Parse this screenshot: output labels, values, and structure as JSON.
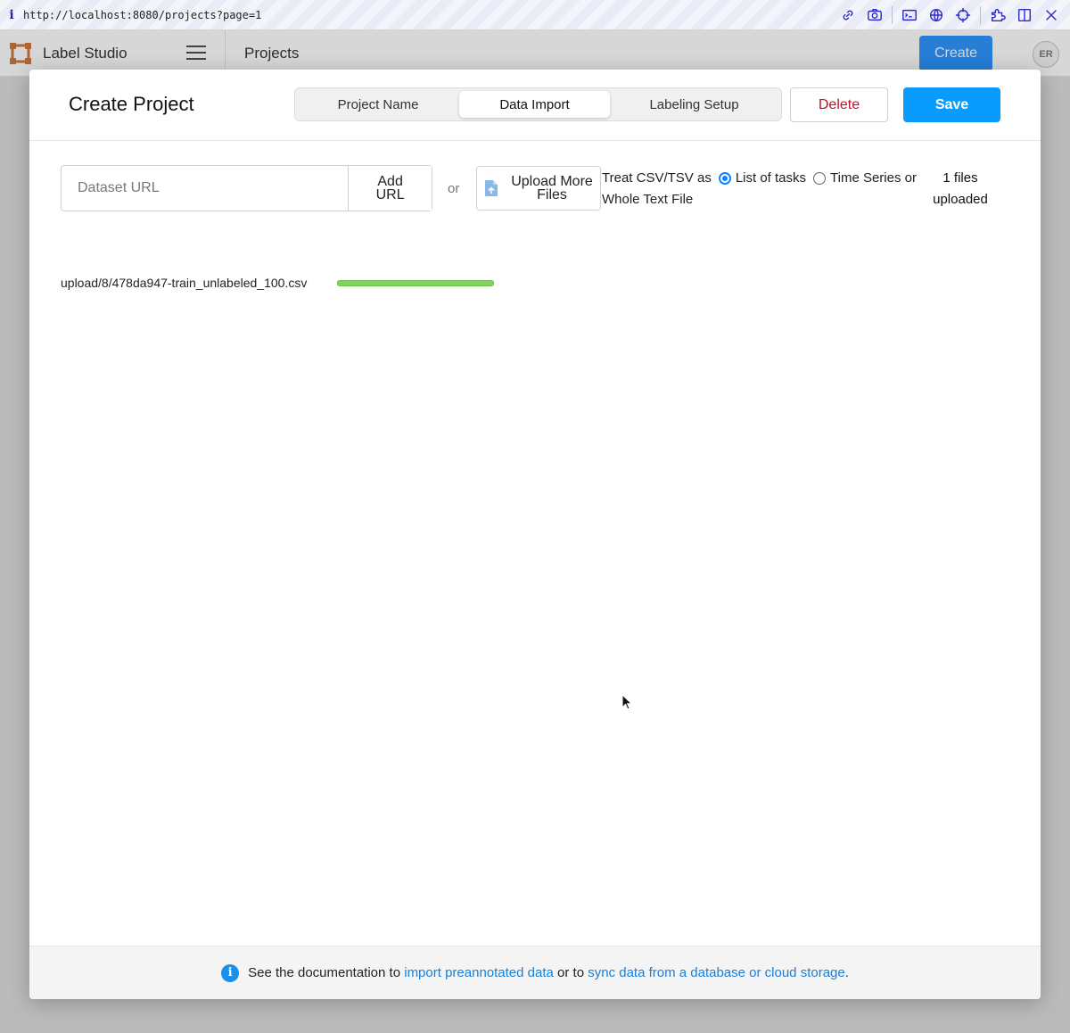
{
  "browser": {
    "url": "http://localhost:8080/projects?page=1",
    "info": "i",
    "tools": [
      "link-icon",
      "camera-icon",
      "terminal-icon",
      "globe-icon",
      "crosshair-icon",
      "extension-icon",
      "split-view-icon",
      "close-icon"
    ]
  },
  "app": {
    "name": "Label Studio",
    "page_title": "Projects",
    "create_label": "Create",
    "avatar_initials": "ER"
  },
  "modal": {
    "title": "Create Project",
    "steps": [
      {
        "label": "Project Name",
        "active": false
      },
      {
        "label": "Data Import",
        "active": true
      },
      {
        "label": "Labeling Setup",
        "active": false
      }
    ],
    "delete_label": "Delete",
    "save_label": "Save"
  },
  "import": {
    "url_placeholder": "Dataset URL",
    "add_url_line1": "Add",
    "add_url_line2": "URL",
    "or_label": "or",
    "upload_line1": "Upload More",
    "upload_line2": "Files",
    "csv_prefix": "Treat CSV/TSV as",
    "option_list": "List of tasks",
    "option_timeseries": "Time Series or",
    "csv_suffix": "Whole Text File",
    "selected_option": "List of tasks",
    "files_count_line1": "1 files",
    "files_count_line2": "uploaded",
    "files": [
      {
        "name": "upload/8/478da947-train_unlabeled_100.csv",
        "progress": 1.0
      }
    ]
  },
  "footer": {
    "text1": "See the documentation to",
    "link1": "import preannotated data",
    "text2": "or to",
    "link2": "sync data from a database or cloud storage",
    "text3": "."
  },
  "colors": {
    "accent": "#0a84ff",
    "save": "#0a9bff",
    "delete_text": "#c0102b",
    "progress": "#83d15f",
    "link": "#1a7fd6",
    "logo": "#c8601e"
  }
}
